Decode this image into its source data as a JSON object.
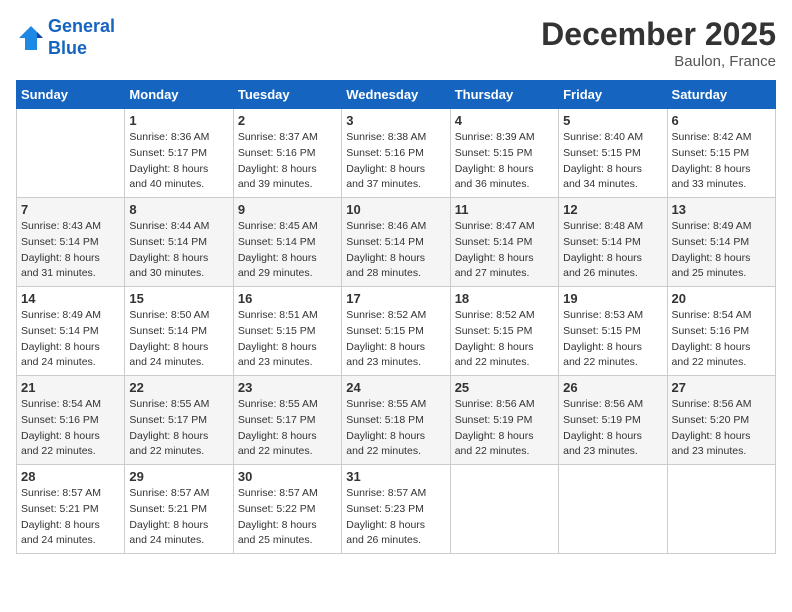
{
  "header": {
    "logo_line1": "General",
    "logo_line2": "Blue",
    "month": "December 2025",
    "location": "Baulon, France"
  },
  "days_of_week": [
    "Sunday",
    "Monday",
    "Tuesday",
    "Wednesday",
    "Thursday",
    "Friday",
    "Saturday"
  ],
  "weeks": [
    [
      {
        "day": "",
        "info": ""
      },
      {
        "day": "1",
        "info": "Sunrise: 8:36 AM\nSunset: 5:17 PM\nDaylight: 8 hours\nand 40 minutes."
      },
      {
        "day": "2",
        "info": "Sunrise: 8:37 AM\nSunset: 5:16 PM\nDaylight: 8 hours\nand 39 minutes."
      },
      {
        "day": "3",
        "info": "Sunrise: 8:38 AM\nSunset: 5:16 PM\nDaylight: 8 hours\nand 37 minutes."
      },
      {
        "day": "4",
        "info": "Sunrise: 8:39 AM\nSunset: 5:15 PM\nDaylight: 8 hours\nand 36 minutes."
      },
      {
        "day": "5",
        "info": "Sunrise: 8:40 AM\nSunset: 5:15 PM\nDaylight: 8 hours\nand 34 minutes."
      },
      {
        "day": "6",
        "info": "Sunrise: 8:42 AM\nSunset: 5:15 PM\nDaylight: 8 hours\nand 33 minutes."
      }
    ],
    [
      {
        "day": "7",
        "info": "Sunrise: 8:43 AM\nSunset: 5:14 PM\nDaylight: 8 hours\nand 31 minutes."
      },
      {
        "day": "8",
        "info": "Sunrise: 8:44 AM\nSunset: 5:14 PM\nDaylight: 8 hours\nand 30 minutes."
      },
      {
        "day": "9",
        "info": "Sunrise: 8:45 AM\nSunset: 5:14 PM\nDaylight: 8 hours\nand 29 minutes."
      },
      {
        "day": "10",
        "info": "Sunrise: 8:46 AM\nSunset: 5:14 PM\nDaylight: 8 hours\nand 28 minutes."
      },
      {
        "day": "11",
        "info": "Sunrise: 8:47 AM\nSunset: 5:14 PM\nDaylight: 8 hours\nand 27 minutes."
      },
      {
        "day": "12",
        "info": "Sunrise: 8:48 AM\nSunset: 5:14 PM\nDaylight: 8 hours\nand 26 minutes."
      },
      {
        "day": "13",
        "info": "Sunrise: 8:49 AM\nSunset: 5:14 PM\nDaylight: 8 hours\nand 25 minutes."
      }
    ],
    [
      {
        "day": "14",
        "info": "Sunrise: 8:49 AM\nSunset: 5:14 PM\nDaylight: 8 hours\nand 24 minutes."
      },
      {
        "day": "15",
        "info": "Sunrise: 8:50 AM\nSunset: 5:14 PM\nDaylight: 8 hours\nand 24 minutes."
      },
      {
        "day": "16",
        "info": "Sunrise: 8:51 AM\nSunset: 5:15 PM\nDaylight: 8 hours\nand 23 minutes."
      },
      {
        "day": "17",
        "info": "Sunrise: 8:52 AM\nSunset: 5:15 PM\nDaylight: 8 hours\nand 23 minutes."
      },
      {
        "day": "18",
        "info": "Sunrise: 8:52 AM\nSunset: 5:15 PM\nDaylight: 8 hours\nand 22 minutes."
      },
      {
        "day": "19",
        "info": "Sunrise: 8:53 AM\nSunset: 5:15 PM\nDaylight: 8 hours\nand 22 minutes."
      },
      {
        "day": "20",
        "info": "Sunrise: 8:54 AM\nSunset: 5:16 PM\nDaylight: 8 hours\nand 22 minutes."
      }
    ],
    [
      {
        "day": "21",
        "info": "Sunrise: 8:54 AM\nSunset: 5:16 PM\nDaylight: 8 hours\nand 22 minutes."
      },
      {
        "day": "22",
        "info": "Sunrise: 8:55 AM\nSunset: 5:17 PM\nDaylight: 8 hours\nand 22 minutes."
      },
      {
        "day": "23",
        "info": "Sunrise: 8:55 AM\nSunset: 5:17 PM\nDaylight: 8 hours\nand 22 minutes."
      },
      {
        "day": "24",
        "info": "Sunrise: 8:55 AM\nSunset: 5:18 PM\nDaylight: 8 hours\nand 22 minutes."
      },
      {
        "day": "25",
        "info": "Sunrise: 8:56 AM\nSunset: 5:19 PM\nDaylight: 8 hours\nand 22 minutes."
      },
      {
        "day": "26",
        "info": "Sunrise: 8:56 AM\nSunset: 5:19 PM\nDaylight: 8 hours\nand 23 minutes."
      },
      {
        "day": "27",
        "info": "Sunrise: 8:56 AM\nSunset: 5:20 PM\nDaylight: 8 hours\nand 23 minutes."
      }
    ],
    [
      {
        "day": "28",
        "info": "Sunrise: 8:57 AM\nSunset: 5:21 PM\nDaylight: 8 hours\nand 24 minutes."
      },
      {
        "day": "29",
        "info": "Sunrise: 8:57 AM\nSunset: 5:21 PM\nDaylight: 8 hours\nand 24 minutes."
      },
      {
        "day": "30",
        "info": "Sunrise: 8:57 AM\nSunset: 5:22 PM\nDaylight: 8 hours\nand 25 minutes."
      },
      {
        "day": "31",
        "info": "Sunrise: 8:57 AM\nSunset: 5:23 PM\nDaylight: 8 hours\nand 26 minutes."
      },
      {
        "day": "",
        "info": ""
      },
      {
        "day": "",
        "info": ""
      },
      {
        "day": "",
        "info": ""
      }
    ]
  ]
}
